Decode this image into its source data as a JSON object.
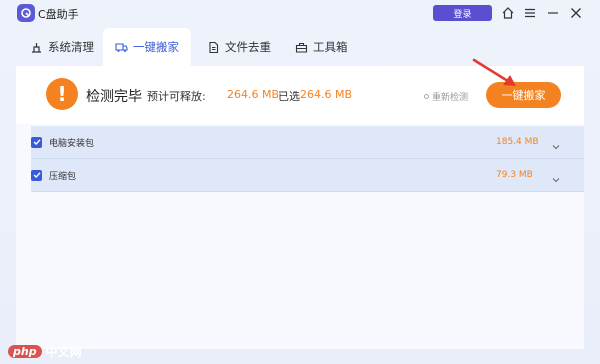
{
  "app": {
    "title": "C盘助手",
    "login_label": "登录"
  },
  "tabs": [
    {
      "label": "系统清理",
      "icon": "broom-icon"
    },
    {
      "label": "一键搬家",
      "icon": "truck-icon",
      "active": true
    },
    {
      "label": "文件去重",
      "icon": "file-icon"
    },
    {
      "label": "工具箱",
      "icon": "toolbox-icon"
    }
  ],
  "summary": {
    "status": "检测完毕",
    "free_label": "预计可释放:",
    "free_value": "264.6 MB",
    "selected_label": "已选",
    "selected_value": "264.6 MB",
    "rescan_label": "重新检测",
    "move_button_label": "一键搬家"
  },
  "items": [
    {
      "name": "电脑安装包",
      "size": "185.4 MB",
      "checked": true
    },
    {
      "name": "压缩包",
      "size": "79.3 MB",
      "checked": true
    }
  ],
  "watermark": {
    "badge": "php",
    "text": "中文网"
  },
  "colors": {
    "accent": "#f58220",
    "primary": "#3a5bd9",
    "login": "#5b4fd1"
  }
}
